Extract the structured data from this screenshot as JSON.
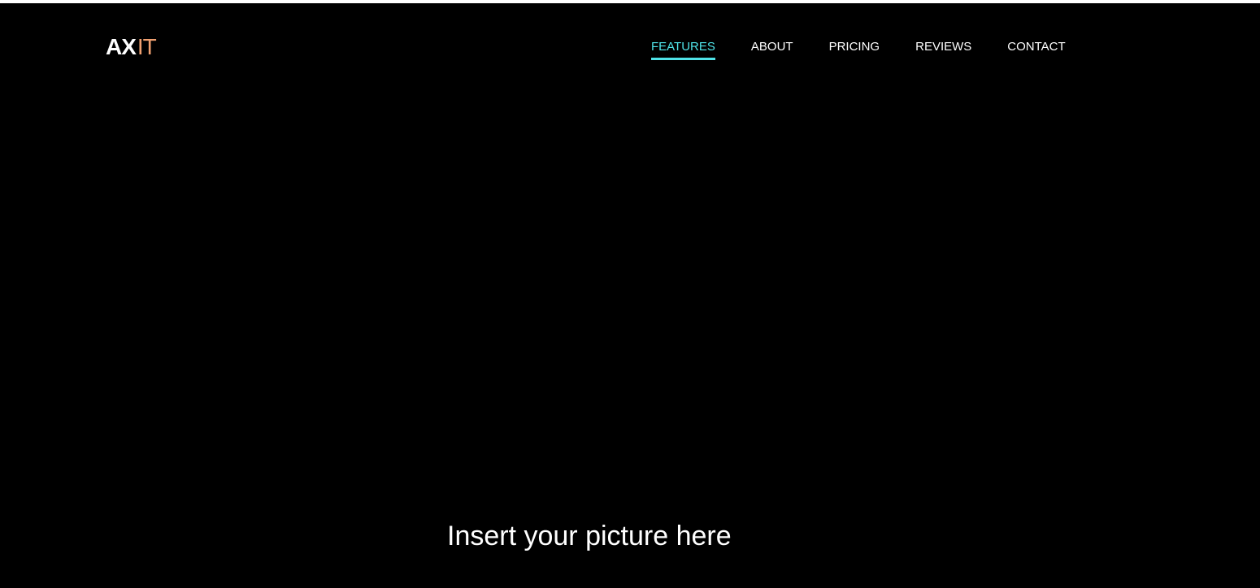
{
  "header": {
    "logo": {
      "bold": "AX",
      "light": "IT"
    },
    "nav": [
      {
        "label": "FEATURES",
        "active": true
      },
      {
        "label": "ABOUT",
        "active": false
      },
      {
        "label": "PRICING",
        "active": false
      },
      {
        "label": "REVIEWS",
        "active": false
      },
      {
        "label": "CONTACT",
        "active": false
      }
    ]
  },
  "hero": {
    "caption": "Insert your picture here"
  },
  "colors": {
    "background": "#000000",
    "accent": "#4fe3e8",
    "logo_light": "#f0a070",
    "text": "#ffffff"
  }
}
